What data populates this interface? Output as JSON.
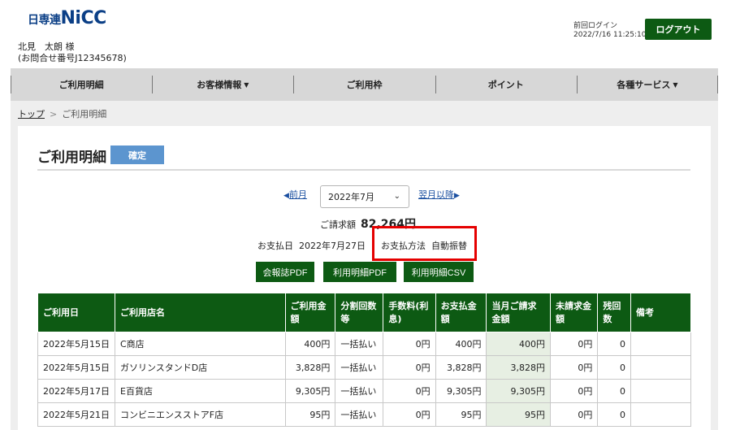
{
  "header": {
    "logo_prefix": "日専連",
    "logo_brand": "NiCC",
    "user_name": "北見　太朗 様",
    "inquiry_number": "(お問合せ番号J12345678)",
    "last_login_label": "前回ログイン",
    "last_login_time": "2022/7/16 11:25:10",
    "logout_label": "ログアウト"
  },
  "nav": {
    "items": [
      {
        "label": "ご利用明細",
        "caret": ""
      },
      {
        "label": "お客様情報",
        "caret": "▼"
      },
      {
        "label": "ご利用枠",
        "caret": ""
      },
      {
        "label": "ポイント",
        "caret": ""
      },
      {
        "label": "各種サービス",
        "caret": "▼"
      }
    ]
  },
  "breadcrumb": {
    "top": "トップ",
    "separator": ">",
    "current": "ご利用明細"
  },
  "main": {
    "title": "ご利用明細",
    "status_badge": "確定",
    "prev_label": "前月",
    "next_label": "翌月以降",
    "selected_month": "2022年7月",
    "billing_label": "ご請求額",
    "billing_amount": "82,264円",
    "pay_date_label": "お支払日",
    "pay_date": "2022年7月27日",
    "pay_method_label": "お支払方法",
    "pay_method": "自動振替",
    "buttons": {
      "pdf_bulletin": "会報誌PDF",
      "pdf_statement": "利用明細PDF",
      "csv_statement": "利用明細CSV"
    }
  },
  "table": {
    "headers": [
      "ご利用日",
      "ご利用店名",
      "ご利用金額",
      "分割回数等",
      "手数料(利息)",
      "お支払金額",
      "当月ご請求金額",
      "未請求金額",
      "残回数",
      "備考"
    ],
    "rows": [
      [
        "2022年5月15日",
        "C商店",
        "400円",
        "一括払い",
        "0円",
        "400円",
        "400円",
        "0円",
        "0",
        ""
      ],
      [
        "2022年5月15日",
        "ガソリンスタンドD店",
        "3,828円",
        "一括払い",
        "0円",
        "3,828円",
        "3,828円",
        "0円",
        "0",
        ""
      ],
      [
        "2022年5月17日",
        "E百貨店",
        "9,305円",
        "一括払い",
        "0円",
        "9,305円",
        "9,305円",
        "0円",
        "0",
        ""
      ],
      [
        "2022年5月21日",
        "コンビニエンスストアF店",
        "95円",
        "一括払い",
        "0円",
        "95円",
        "95円",
        "0円",
        "0",
        ""
      ]
    ]
  },
  "colors": {
    "brand_green": "#0d5a13",
    "badge_blue": "#5c95cf",
    "highlight_red": "#e50000",
    "link_blue": "#1a4fa0"
  }
}
